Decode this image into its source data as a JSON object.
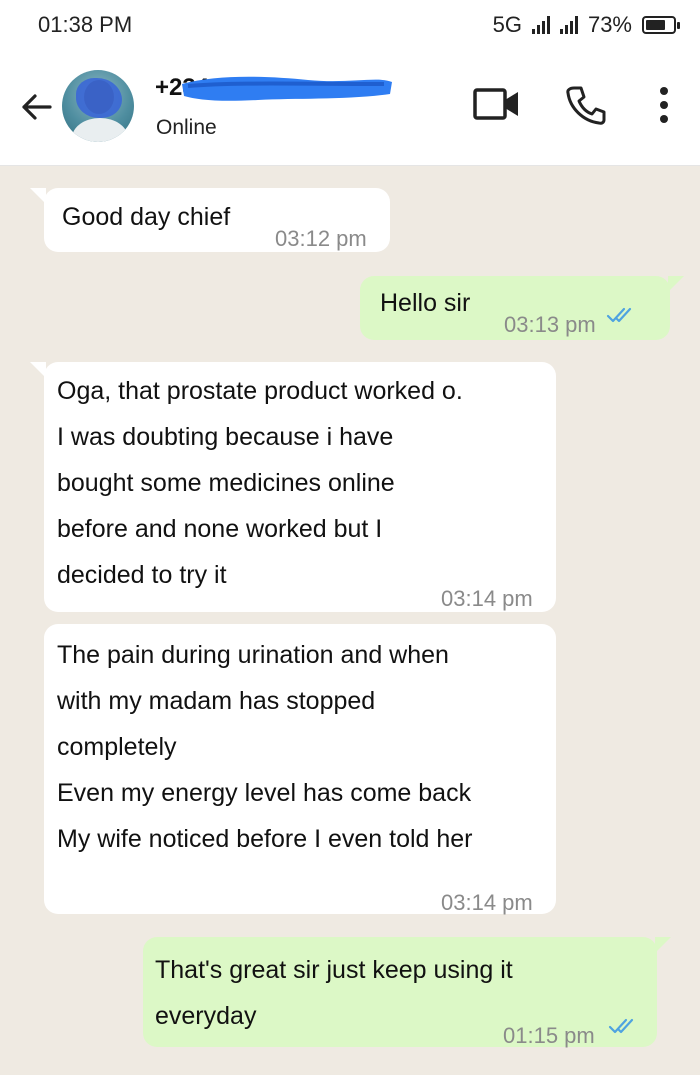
{
  "status_bar": {
    "time": "01:38 PM",
    "network": "5G",
    "battery_percent": "73%",
    "battery_level": 0.73
  },
  "header": {
    "contact_name": "+234",
    "contact_status": "Online",
    "icons": [
      "back-arrow-icon",
      "video-call-icon",
      "phone-icon",
      "more-vertical-icon"
    ]
  },
  "messages": [
    {
      "direction": "in",
      "text": "Good day chief",
      "time": "03:12 pm"
    },
    {
      "direction": "out",
      "text": "Hello sir",
      "time": "03:13 pm",
      "read": true
    },
    {
      "direction": "in",
      "text": " Oga, that prostate product worked o.\nI was doubting because i have\nbought some medicines online\nbefore and none worked but I\ndecided to try it",
      "time": "03:14 pm"
    },
    {
      "direction": "in",
      "text": " The pain during urination and when\nwith my madam has stopped\ncompletely\nEven my energy level has come back\nMy wife noticed before I even told her",
      "time": "03:14 pm"
    },
    {
      "direction": "out",
      "text": " That's great sir just keep using it\neveryday",
      "time": "01:15 pm",
      "read": true
    }
  ],
  "colors": {
    "chat_background": "#efeae2",
    "incoming_bubble": "#ffffff",
    "outgoing_bubble": "#dcf8c6",
    "read_ticks": "#4fa3e0"
  }
}
